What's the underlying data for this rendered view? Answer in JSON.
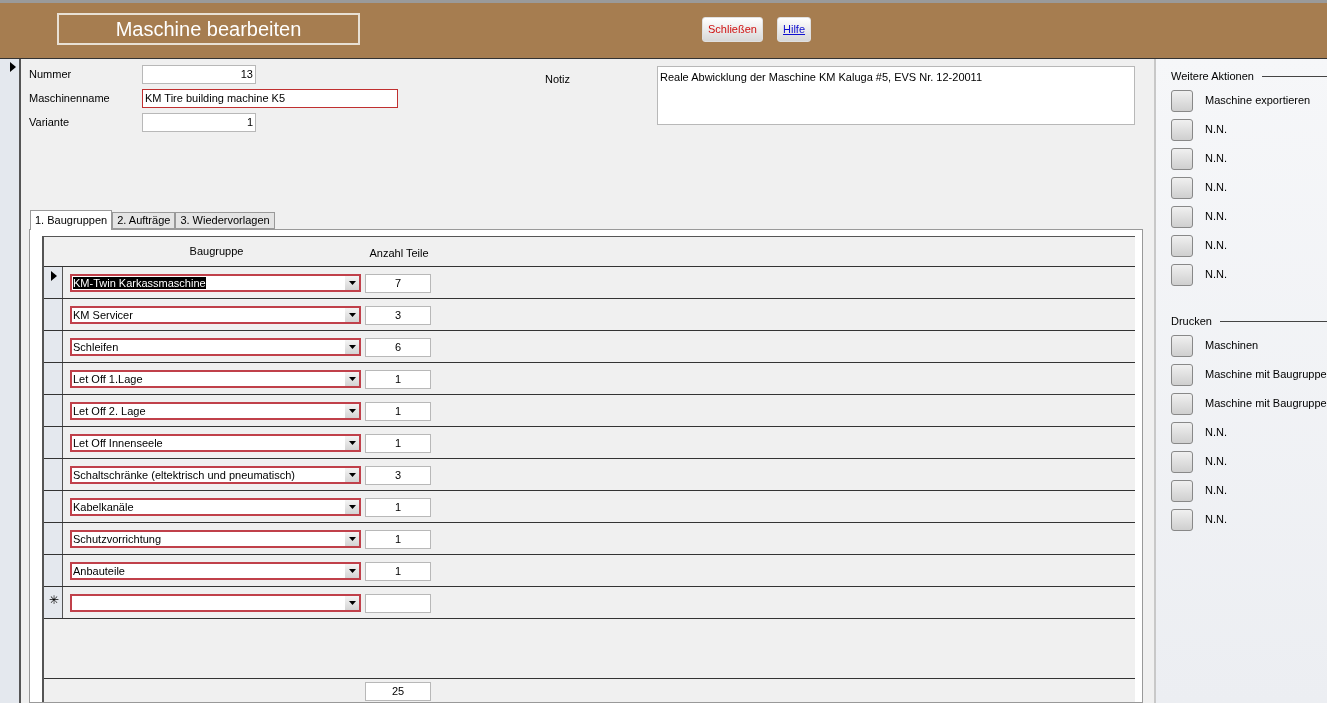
{
  "window": {
    "title": "Maschine bearbeiten"
  },
  "toolbar": [
    {
      "label": "Schließen",
      "kind": "close"
    },
    {
      "label": "Hilfe",
      "kind": "help"
    }
  ],
  "fields": [
    {
      "label": "Nummer",
      "value": "13",
      "kind": "number",
      "required": false
    },
    {
      "label": "Maschinenname",
      "value": "KM Tire building machine K5",
      "kind": "text",
      "required": true
    },
    {
      "label": "Variante",
      "value": "1",
      "kind": "number",
      "required": false
    }
  ],
  "note": {
    "label": "Notiz",
    "value": "Reale Abwicklung der Maschine KM Kaluga #5, EVS Nr. 12-20011"
  },
  "tabs": [
    {
      "label": "1. Baugruppen",
      "selected": true
    },
    {
      "label": "2. Aufträge",
      "selected": false
    },
    {
      "label": "3. Wiedervorlagen",
      "selected": false
    }
  ],
  "table": {
    "columns": [
      "Baugruppe",
      "Anzahl Teile"
    ],
    "rows": [
      {
        "baugruppe": "KM-Twin Karkassmaschine",
        "anzahl": "7",
        "current": true
      },
      {
        "baugruppe": "KM Servicer",
        "anzahl": "3",
        "current": false
      },
      {
        "baugruppe": "Schleifen",
        "anzahl": "6",
        "current": false
      },
      {
        "baugruppe": "Let Off 1.Lage",
        "anzahl": "1",
        "current": false
      },
      {
        "baugruppe": "Let Off 2. Lage",
        "anzahl": "1",
        "current": false
      },
      {
        "baugruppe": "Let Off Innenseele",
        "anzahl": "1",
        "current": false
      },
      {
        "baugruppe": "Schaltschränke (eltektrisch und pneumatisch)",
        "anzahl": "3",
        "current": false
      },
      {
        "baugruppe": "Kabelkanäle",
        "anzahl": "1",
        "current": false
      },
      {
        "baugruppe": "Schutzvorrichtung",
        "anzahl": "1",
        "current": false
      },
      {
        "baugruppe": "Anbauteile",
        "anzahl": "1",
        "current": false
      }
    ],
    "new_row_marker": "✳",
    "total": "25"
  },
  "side_panel": [
    {
      "title": "Weitere Aktionen",
      "actions": [
        "Maschine exportieren",
        "N.N.",
        "N.N.",
        "N.N.",
        "N.N.",
        "N.N.",
        "N.N."
      ]
    },
    {
      "title": "Drucken",
      "actions": [
        "Maschinen",
        "Maschine mit Baugruppe",
        "Maschine mit Baugruppe",
        "N.N.",
        "N.N.",
        "N.N.",
        "N.N."
      ]
    }
  ]
}
